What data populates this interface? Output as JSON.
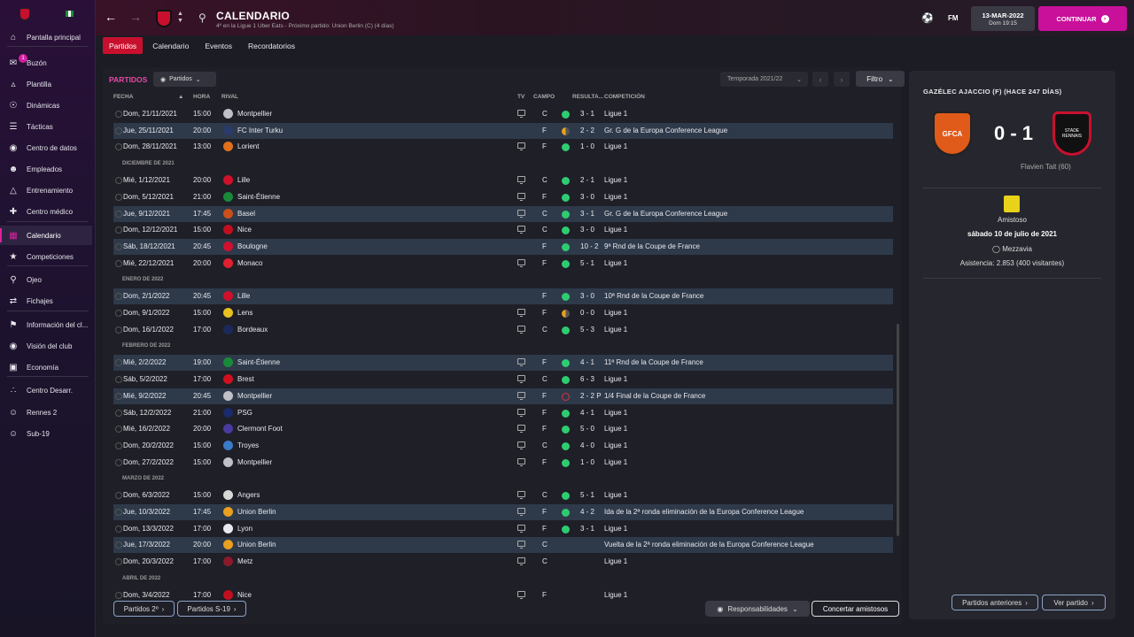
{
  "sidebar": {
    "items": [
      {
        "label": "Pantalla principal",
        "icon": "home-icon"
      },
      {
        "label": "Buzón",
        "icon": "inbox-icon",
        "badge": "1"
      },
      {
        "label": "Plantilla",
        "icon": "shirt-icon"
      },
      {
        "label": "Dinámicas",
        "icon": "dynamics-icon"
      },
      {
        "label": "Tácticas",
        "icon": "tactics-icon"
      },
      {
        "label": "Centro de datos",
        "icon": "data-icon"
      },
      {
        "label": "Empleados",
        "icon": "staff-icon"
      },
      {
        "label": "Entrenamiento",
        "icon": "training-icon"
      },
      {
        "label": "Centro médico",
        "icon": "medical-icon"
      },
      {
        "label": "Calendario",
        "icon": "calendar-icon"
      },
      {
        "label": "Competiciones",
        "icon": "trophy-icon"
      },
      {
        "label": "Ojeo",
        "icon": "scouting-icon"
      },
      {
        "label": "Fichajes",
        "icon": "transfers-icon"
      },
      {
        "label": "Información del cl...",
        "icon": "club-info-icon"
      },
      {
        "label": "Visión del club",
        "icon": "vision-icon"
      },
      {
        "label": "Economía",
        "icon": "finances-icon"
      },
      {
        "label": "Centro Desarr.",
        "icon": "development-icon"
      },
      {
        "label": "Rennes 2",
        "icon": "team-icon"
      },
      {
        "label": "Sub-19",
        "icon": "team-icon"
      }
    ]
  },
  "header": {
    "title": "CALENDARIO",
    "subtitle": "4º en la Ligue 1 Uber Eats - Próximo partido: Union Berlin (C)  (4 días)",
    "fm": "FM",
    "date": "13-MAR-2022",
    "date_sub": "Dom 19:15",
    "continue": "CONTINUAR"
  },
  "tabs": [
    "Partidos",
    "Calendario",
    "Eventos",
    "Recordatorios"
  ],
  "panel": {
    "title": "PARTIDOS",
    "filter": "Partidos",
    "season": "Temporada 2021/22",
    "filtro": "Filtro"
  },
  "columns": {
    "fecha": "FECHA",
    "hora": "HORA",
    "rival": "RIVAL",
    "tv": "TV",
    "campo": "CAMPO",
    "resultado": "RESULTA...",
    "competicion": "COMPETICIÓN"
  },
  "rows": [
    {
      "date": "Dom, 21/11/2021",
      "time": "15:00",
      "rival": "Montpellier",
      "tv": true,
      "venue": "C",
      "res": "w",
      "score": "3 - 1",
      "comp": "Ligue 1",
      "hl": false,
      "logo": "#c0c0c8"
    },
    {
      "date": "Jue, 25/11/2021",
      "time": "20:00",
      "rival": "FC Inter Turku",
      "tv": false,
      "venue": "F",
      "res": "d",
      "score": "2 - 2",
      "comp": "Gr. G de la Europa Conference League",
      "hl": true,
      "logo": "#2a3a6a"
    },
    {
      "date": "Dom, 28/11/2021",
      "time": "13:00",
      "rival": "Lorient",
      "tv": true,
      "venue": "F",
      "res": "w",
      "score": "1 - 0",
      "comp": "Ligue 1",
      "hl": false,
      "logo": "#e0701a"
    },
    {
      "header": "DICIEMBRE DE 2021"
    },
    {
      "date": "Mié, 1/12/2021",
      "time": "20:00",
      "rival": "Lille",
      "tv": true,
      "venue": "C",
      "res": "w",
      "score": "2 - 1",
      "comp": "Ligue 1",
      "hl": false,
      "logo": "#d0102a"
    },
    {
      "date": "Dom, 5/12/2021",
      "time": "21:00",
      "rival": "Saint-Étienne",
      "tv": true,
      "venue": "F",
      "res": "w",
      "score": "3 - 0",
      "comp": "Ligue 1",
      "hl": false,
      "logo": "#1a8a3a"
    },
    {
      "date": "Jue, 9/12/2021",
      "time": "17:45",
      "rival": "Basel",
      "tv": true,
      "venue": "C",
      "res": "w",
      "score": "3 - 1",
      "comp": "Gr. G de la Europa Conference League",
      "hl": true,
      "logo": "#c8501a"
    },
    {
      "date": "Dom, 12/12/2021",
      "time": "15:00",
      "rival": "Nice",
      "tv": true,
      "venue": "C",
      "res": "w",
      "score": "3 - 0",
      "comp": "Ligue 1",
      "hl": false,
      "logo": "#c01020"
    },
    {
      "date": "Sáb, 18/12/2021",
      "time": "20:45",
      "rival": "Boulogne",
      "tv": false,
      "venue": "F",
      "res": "w",
      "score": "10 - 2",
      "comp": "9ª Rnd de la Coupe de France",
      "hl": true,
      "logo": "#d01030"
    },
    {
      "date": "Mié, 22/12/2021",
      "time": "20:00",
      "rival": "Monaco",
      "tv": true,
      "venue": "F",
      "res": "w",
      "score": "5 - 1",
      "comp": "Ligue 1",
      "hl": false,
      "logo": "#e02030"
    },
    {
      "header": "ENERO DE 2022"
    },
    {
      "date": "Dom, 2/1/2022",
      "time": "20:45",
      "rival": "Lille",
      "tv": false,
      "venue": "F",
      "res": "w",
      "score": "3 - 0",
      "comp": "10ª Rnd de la Coupe de France",
      "hl": true,
      "logo": "#d0102a"
    },
    {
      "date": "Dom, 9/1/2022",
      "time": "15:00",
      "rival": "Lens",
      "tv": true,
      "venue": "F",
      "res": "d",
      "score": "0 - 0",
      "comp": "Ligue 1",
      "hl": false,
      "logo": "#e8c020"
    },
    {
      "date": "Dom, 16/1/2022",
      "time": "17:00",
      "rival": "Bordeaux",
      "tv": true,
      "venue": "C",
      "res": "w",
      "score": "5 - 3",
      "comp": "Ligue 1",
      "hl": false,
      "logo": "#1a2a5a"
    },
    {
      "header": "FEBRERO DE 2022"
    },
    {
      "date": "Mié, 2/2/2022",
      "time": "19:00",
      "rival": "Saint-Étienne",
      "tv": true,
      "venue": "F",
      "res": "w",
      "score": "4 - 1",
      "comp": "11ª Rnd de la Coupe de France",
      "hl": true,
      "logo": "#1a8a3a"
    },
    {
      "date": "Sáb, 5/2/2022",
      "time": "17:00",
      "rival": "Brest",
      "tv": true,
      "venue": "C",
      "res": "w",
      "score": "6 - 3",
      "comp": "Ligue 1",
      "hl": false,
      "logo": "#d01020"
    },
    {
      "date": "Mié, 9/2/2022",
      "time": "20:45",
      "rival": "Montpellier",
      "tv": true,
      "venue": "F",
      "res": "l",
      "score": "2 - 2 P",
      "comp": "1/4 Final de la Coupe de France",
      "hl": true,
      "logo": "#c0c0c8"
    },
    {
      "date": "Sáb, 12/2/2022",
      "time": "21:00",
      "rival": "PSG",
      "tv": true,
      "venue": "F",
      "res": "w",
      "score": "4 - 1",
      "comp": "Ligue 1",
      "hl": false,
      "logo": "#1a2a6a"
    },
    {
      "date": "Mié, 16/2/2022",
      "time": "20:00",
      "rival": "Clermont Foot",
      "tv": true,
      "venue": "F",
      "res": "w",
      "score": "5 - 0",
      "comp": "Ligue 1",
      "hl": false,
      "logo": "#4a3aa0"
    },
    {
      "date": "Dom, 20/2/2022",
      "time": "15:00",
      "rival": "Troyes",
      "tv": true,
      "venue": "C",
      "res": "w",
      "score": "4 - 0",
      "comp": "Ligue 1",
      "hl": false,
      "logo": "#3a7ac8"
    },
    {
      "date": "Dom, 27/2/2022",
      "time": "15:00",
      "rival": "Montpellier",
      "tv": true,
      "venue": "F",
      "res": "w",
      "score": "1 - 0",
      "comp": "Ligue 1",
      "hl": false,
      "logo": "#c0c0c8"
    },
    {
      "header": "MARZO DE 2022"
    },
    {
      "date": "Dom, 6/3/2022",
      "time": "15:00",
      "rival": "Angers",
      "tv": true,
      "venue": "C",
      "res": "w",
      "score": "5 - 1",
      "comp": "Ligue 1",
      "hl": false,
      "logo": "#d8d8d8"
    },
    {
      "date": "Jue, 10/3/2022",
      "time": "17:45",
      "rival": "Union Berlin",
      "tv": true,
      "venue": "F",
      "res": "w",
      "score": "4 - 2",
      "comp": "Ida de la 2ª ronda eliminación de la Europa Conference League",
      "hl": true,
      "logo": "#e8a020"
    },
    {
      "date": "Dom, 13/3/2022",
      "time": "17:00",
      "rival": "Lyon",
      "tv": true,
      "venue": "F",
      "res": "w",
      "score": "3 - 1",
      "comp": "Ligue 1",
      "hl": false,
      "logo": "#e8e8f0"
    },
    {
      "date": "Jue, 17/3/2022",
      "time": "20:00",
      "rival": "Union Berlin",
      "tv": true,
      "venue": "C",
      "res": "",
      "score": "",
      "comp": "Vuelta de la 2ª ronda eliminación de la Europa Conference League",
      "hl": true,
      "logo": "#e8a020"
    },
    {
      "date": "Dom, 20/3/2022",
      "time": "17:00",
      "rival": "Metz",
      "tv": true,
      "venue": "C",
      "res": "",
      "score": "",
      "comp": "Ligue 1",
      "hl": false,
      "logo": "#8a1a2a"
    },
    {
      "header": "ABRIL DE 2022"
    },
    {
      "date": "Dom, 3/4/2022",
      "time": "17:00",
      "rival": "Nice",
      "tv": true,
      "venue": "F",
      "res": "",
      "score": "",
      "comp": "Ligue 1",
      "hl": false,
      "logo": "#c01020"
    }
  ],
  "bottom": {
    "btn1": "Partidos 2º",
    "btn2": "Partidos S-19",
    "resp": "Responsabilidades",
    "friendly": "Concertar amistosos"
  },
  "last_match": {
    "title": "GAZÉLEC AJACCIO (F)  (HACE 247 DÍAS)",
    "home_crest_text": "GFCA",
    "away_crest_text": "STADE RENNAIS",
    "score": "0 - 1",
    "scorer": "Flavien Tait (60)",
    "competition": "Amistoso",
    "date": "sábado 10 de julio de 2021",
    "stadium": "Mezzavia",
    "attendance": "Asistencia: 2.853 (400 visitantes)",
    "prev_btn": "Partidos anteriores",
    "view_btn": "Ver partido"
  },
  "colors": {
    "accent": "#c8109a",
    "win": "#2ecc71",
    "draw": "#e8a020",
    "loss": "#e03040",
    "highlight": "#2e3a4a"
  }
}
